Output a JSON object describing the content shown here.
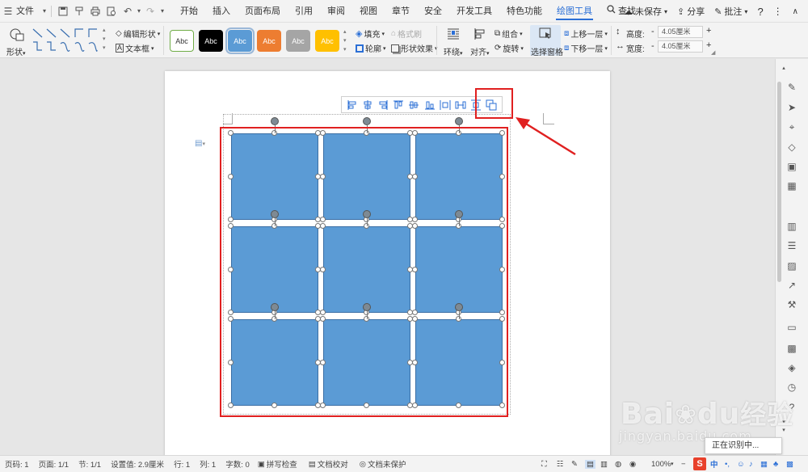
{
  "menubar": {
    "file": "文件",
    "tabs": [
      "开始",
      "插入",
      "页面布局",
      "引用",
      "审阅",
      "视图",
      "章节",
      "安全",
      "开发工具",
      "特色功能",
      "绘图工具"
    ],
    "active_tab": "绘图工具",
    "search": "查找",
    "unsaved": "未保存",
    "share": "分享",
    "comment": "批注"
  },
  "ribbon": {
    "shape": "形状",
    "edit_shape": "编辑形状",
    "text_box": "文本框",
    "style_label": "Abc",
    "fill": "填充",
    "format_brush": "格式刷",
    "outline": "轮廓",
    "shape_effect": "形状效果",
    "wrap": "环绕",
    "align": "对齐",
    "group": "组合",
    "rotate": "旋转",
    "select_pane": "选择窗格",
    "bring_forward": "上移一层",
    "send_backward": "下移一层",
    "height_label": "高度:",
    "width_label": "宽度:",
    "height_value": "4.05厘米",
    "width_value": "4.05厘米",
    "minus": "-",
    "plus": "+",
    "colors": {
      "white": "#ffffff",
      "black": "#000000",
      "blue": "#5b9bd5",
      "orange": "#ed7d31",
      "gray": "#a5a5a5",
      "yellow": "#ffc000"
    }
  },
  "overlay": {
    "recognizing": "正在识别中..."
  },
  "statusbar": {
    "page_num": "页码: 1",
    "pages": "页面: 1/1",
    "section": "节: 1/1",
    "setting": "设置值: 2.9厘米",
    "row": "行: 1",
    "col": "列: 1",
    "word_count": "字数: 0",
    "spell_check": "拼写检查",
    "doc_proof": "文档校对",
    "doc_protect": "文档未保护",
    "zoom": "100%",
    "ime_zh": "中"
  },
  "watermark": {
    "brand": "Bai",
    "brand2": "du",
    "brand_cn": "经验",
    "url": "jingyan.baidu.com"
  }
}
